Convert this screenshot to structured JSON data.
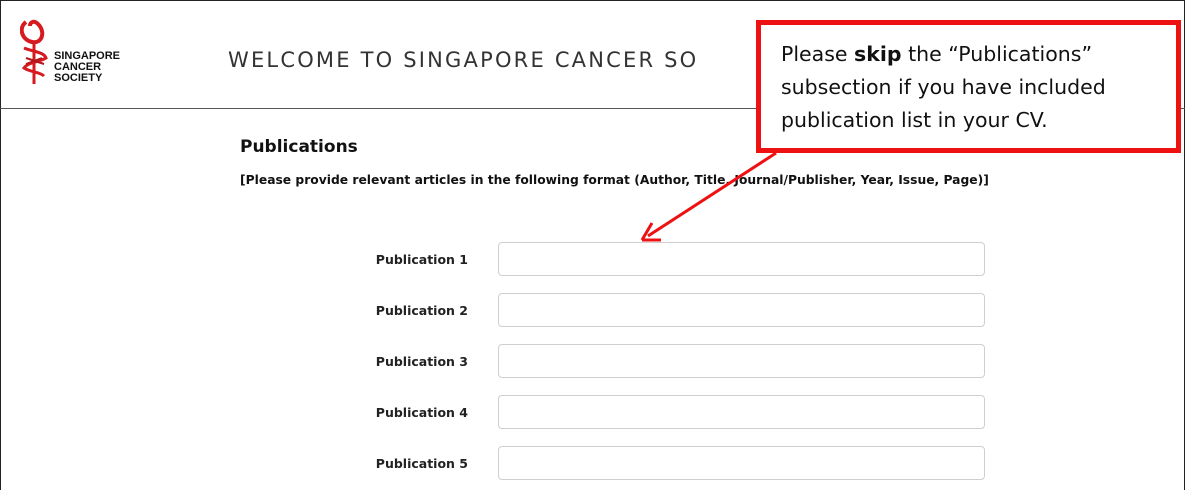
{
  "header": {
    "logo_lines": [
      "SINGAPORE",
      "CANCER",
      "SOCIETY"
    ],
    "welcome_text": "WELCOME TO SINGAPORE CANCER SO"
  },
  "section": {
    "title": "Publications",
    "description": "[Please provide relevant articles in the following format (Author, Title, Journal/Publisher, Year, Issue, Page)]"
  },
  "publications": [
    {
      "label": "Publication 1",
      "value": ""
    },
    {
      "label": "Publication 2",
      "value": ""
    },
    {
      "label": "Publication 3",
      "value": ""
    },
    {
      "label": "Publication 4",
      "value": ""
    },
    {
      "label": "Publication 5",
      "value": ""
    }
  ],
  "callout": {
    "text_before": "Please ",
    "text_bold": "skip",
    "text_after": " the “Publications” subsection if you have included publication list in your CV.",
    "border_color": "#ee1111"
  },
  "colors": {
    "logo_red": "#d71920",
    "annotation_red": "#ee1111"
  }
}
